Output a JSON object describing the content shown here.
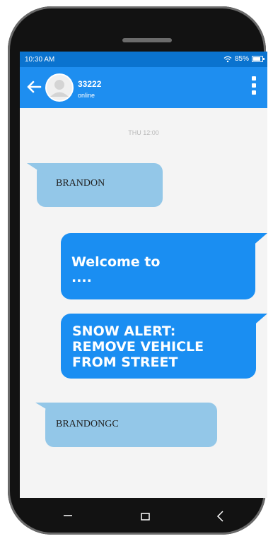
{
  "status_bar": {
    "time": "10:30 AM",
    "battery": "85%"
  },
  "header": {
    "contact_name": "33222",
    "contact_status": "online"
  },
  "conversation": {
    "date_separator": "THU 12:00",
    "messages": [
      {
        "direction": "incoming",
        "text": "BRANDON"
      },
      {
        "direction": "outgoing",
        "lines": [
          "Welcome to",
          "...."
        ]
      },
      {
        "direction": "outgoing",
        "lines": [
          "SNOW ALERT:",
          "REMOVE VEHICLE",
          "FROM STREET"
        ]
      },
      {
        "direction": "incoming",
        "text": "BRANDONGC"
      }
    ]
  },
  "icons": {
    "back": "arrow-left-icon",
    "menu": "more-vertical-icon",
    "wifi": "wifi-icon",
    "battery": "battery-icon",
    "nav": [
      "minus-icon",
      "square-icon",
      "chevron-left-icon"
    ]
  },
  "colors": {
    "app_bar": "#1e8ef0",
    "status_bar": "#0a73cf",
    "incoming_bubble": "#93c7e8",
    "outgoing_bubble": "#1a8ef2"
  }
}
